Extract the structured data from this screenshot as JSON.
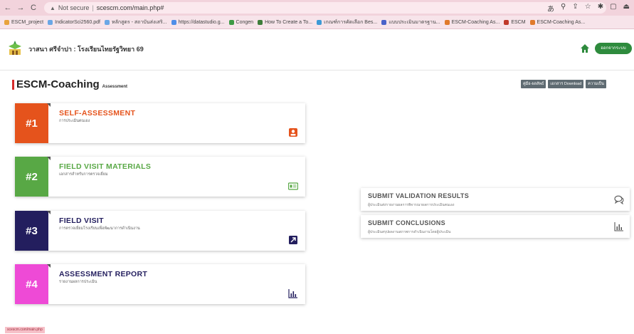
{
  "browser": {
    "not_secure": "Not secure",
    "url": "scescm.com/main.php#",
    "bookmarks": [
      {
        "label": "ESCM_project",
        "color": "#e8a33d"
      },
      {
        "label": "IndicatorSci2560.pdf",
        "color": "#6aa7e6"
      },
      {
        "label": "หลักสูตร - สถาบันส่งเสริ...",
        "color": "#6aa7e6"
      },
      {
        "label": "https://datastudio.g...",
        "color": "#4f8ee8"
      },
      {
        "label": "Congen",
        "color": "#3d9a45"
      },
      {
        "label": "How To Create a To...",
        "color": "#3d7d3a"
      },
      {
        "label": "เกณฑ์การคัดเลือก Bes...",
        "color": "#3d9ad6"
      },
      {
        "label": "แบบประเมินมาตรฐาน...",
        "color": "#4a63c9"
      },
      {
        "label": "ESCM-Coaching As...",
        "color": "#e07a2b"
      },
      {
        "label": "ESCM",
        "color": "#c0392b"
      },
      {
        "label": "ESCM-Coaching As...",
        "color": "#e07a2b"
      }
    ]
  },
  "header": {
    "user_text": "วาสนา ศรีจำปา : โรงเรียนไทยรัฐวิทยา 69",
    "logout_label": "ออกจากระบบ"
  },
  "page": {
    "title": "ESCM-Coaching",
    "subtitle": "Assessment",
    "tools": [
      "คู่มือ-ผลลัพธ์",
      "เอกสาร Download",
      "ความเป็น"
    ]
  },
  "cards": [
    {
      "num": "#1",
      "title": "SELF-ASSESSMENT",
      "sub": "การประเมินตนเอง"
    },
    {
      "num": "#2",
      "title": "FIELD VISIT MATERIALS",
      "sub": "เอกสารสำหรับการตรวจเยี่ยม"
    },
    {
      "num": "#3",
      "title": "FIELD VISIT",
      "sub": "การตรวจเยี่ยมโรงเรียนเพื่อพัฒนาการดำเนินงาน"
    },
    {
      "num": "#4",
      "title": "ASSESSMENT REPORT",
      "sub": "รายงานผลการประเมิน"
    }
  ],
  "side_cards": [
    {
      "title": "SUBMIT VALIDATION RESULTS",
      "sub": "ผู้ประเมินส่งรายงานผลการพิจารณาผลการประเมินตนเอง"
    },
    {
      "title": "SUBMIT CONCLUSIONS",
      "sub": "ผู้ประเมินสรุปผลงานสภาพการดำเนินงานโดยผู้ประเมิน"
    }
  ],
  "footer": {
    "link": "scescm.com/main.php"
  }
}
